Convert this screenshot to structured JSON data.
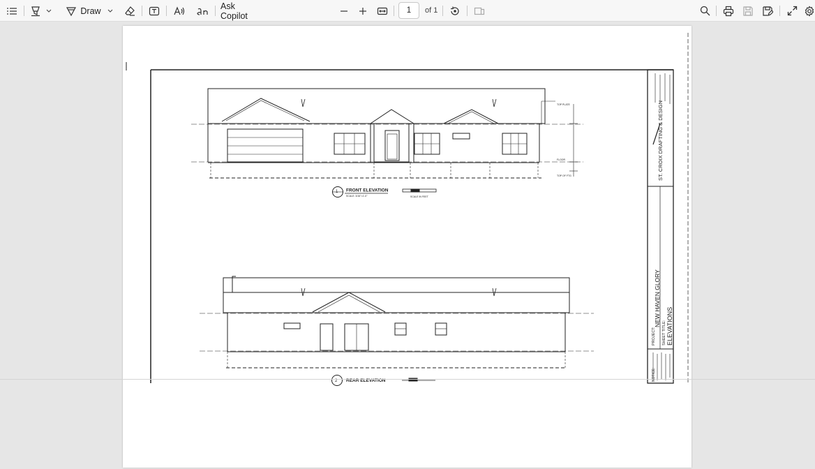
{
  "toolbar": {
    "draw_label": "Draw",
    "copilot_label": "Ask Copilot",
    "page_current": "1",
    "page_total": "of 1",
    "icons": [
      "contents-icon",
      "highlight-icon",
      "chevron-down-icon",
      "draw-icon",
      "chevron-down-icon",
      "eraser-icon",
      "text-box-icon",
      "read-aloud-icon",
      "translate-icon",
      "zoom-out-icon",
      "zoom-in-icon",
      "fit-page-icon",
      "rotate-icon",
      "two-page-icon",
      "search-icon",
      "print-icon",
      "save-icon",
      "save-as-icon",
      "fullscreen-icon",
      "settings-icon"
    ]
  },
  "document": {
    "sheet": {
      "company": "ST. CROIX DRAFTING & DESIGN",
      "project_label": "PROJECT:",
      "project_name": "NEW HAVEN GLORY",
      "sheet_title_label": "SHEET TITLE:",
      "sheet_title": "ELEVATIONS",
      "notice_label": "NOTICE:"
    },
    "views": [
      {
        "number": "1",
        "title": "FRONT ELEVATION",
        "scale": "SCALE: 3/16\"=1'-0\"",
        "scale_bar_label": "SCALE IN FEET"
      },
      {
        "number": "2",
        "title": "REAR ELEVATION"
      }
    ],
    "annotations": {
      "level_top_plate": "TOP PLATE",
      "level_floor": "FLOOR",
      "level_footing": "TOP OF FTG"
    }
  }
}
